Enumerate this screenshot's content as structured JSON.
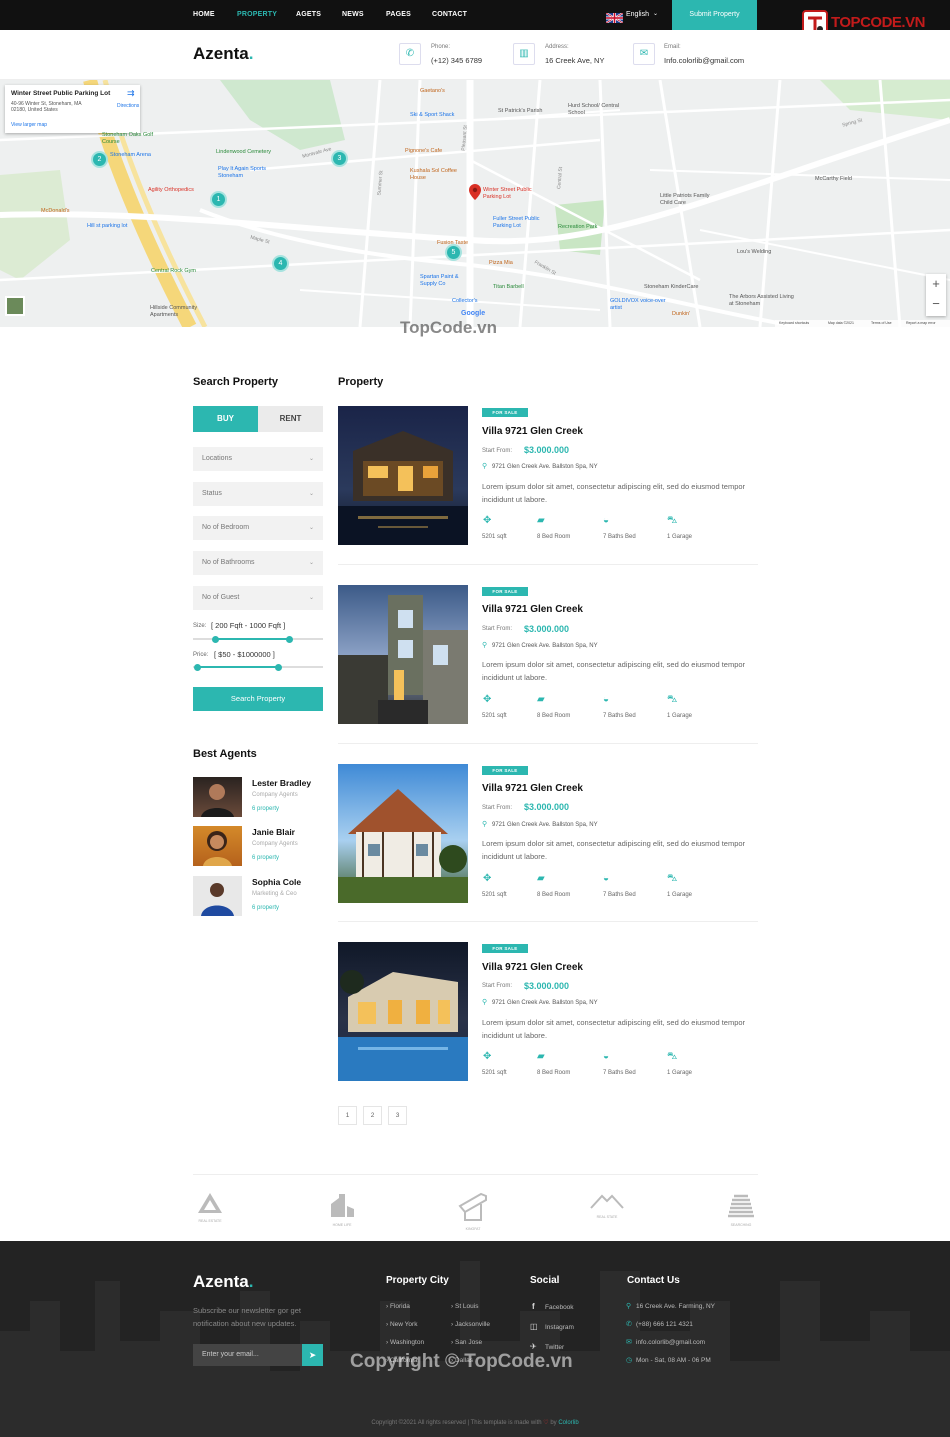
{
  "nav": {
    "items": [
      "HOME",
      "PROPERTY",
      "AGETS",
      "NEWS",
      "PAGES",
      "CONTACT"
    ],
    "active": "PROPERTY",
    "language": "English",
    "submit_label": "Submit Property"
  },
  "logo": {
    "brand": "TOPCODE.VN"
  },
  "header": {
    "logo": "Azenta",
    "logo_dot": ".",
    "phone_label": "Phone:",
    "phone": "(+12) 345 6789",
    "address_label": "Address:",
    "address": "16 Creek Ave, NY",
    "email_label": "Email:",
    "email": "Info.colorlib@gmail.com"
  },
  "map": {
    "info_title": "Winter Street Public Parking Lot",
    "info_line1": "40-96 Winter St, Stoneham, MA",
    "info_line2": "02180, United States",
    "larger_map": "View larger map",
    "directions": "Directions",
    "labels": [
      "Gaetano's",
      "Ski & Sport Shack",
      "St Patrick's Parish",
      "Hurd School/ Central School",
      "Stoneham Oaks Golf Course",
      "Lindenwood Cemetery",
      "Stoneham Arena",
      "Play It Again Sports Stoneham",
      "Pignone's Cafe",
      "Kushala Sol Coffee House",
      "Winter Street Public Parking Lot",
      "Agility Orthopedics",
      "McDonald's",
      "Hill st parking lot",
      "Fuller Street Public Parking Lot",
      "Recreation Park",
      "Little Patriots Family Child Care",
      "McCarthy Field",
      "Fusion Taste",
      "Pizza Mia",
      "Lou's Welding",
      "Central Rock Gym",
      "Spartan Paint & Supply Co",
      "Titan Barbell",
      "Stoneham KinderCare",
      "The Arbors Assisted Living at Stoneham",
      "Hillside Community Apartments",
      "Collector's",
      "GOLDIVOX voice-over artist",
      "Dunkin'",
      "Montvale Ave",
      "Maple St",
      "Pleasant St",
      "Summer St",
      "Central St",
      "Spring St",
      "Franklin St"
    ],
    "markers": [
      "1",
      "2",
      "3",
      "4",
      "5"
    ],
    "zoom_in": "+",
    "zoom_out": "−",
    "footer": [
      "Keyboard shortcuts",
      "Map data ©2021",
      "Terms of Use",
      "Report a map error"
    ],
    "google": "Google"
  },
  "watermark": {
    "top": "TopCode.vn",
    "bottom": "Copyright © TopCode.vn"
  },
  "search": {
    "title": "Search Property",
    "buy": "BUY",
    "rent": "RENT",
    "selects": [
      "Locations",
      "Status",
      "No of Bedroom",
      "No of Bathrooms",
      "No of Guest"
    ],
    "size_label": "Size:",
    "size_value": "[ 200 Fqft - 1000 Fqft ]",
    "price_label": "Price:",
    "price_value": "[ $50 - $1000000 ]",
    "size_range": [
      0.17,
      0.74
    ],
    "price_range": [
      0.03,
      0.65
    ],
    "button": "Search Property"
  },
  "agents": {
    "title": "Best Agents",
    "items": [
      {
        "name": "Lester Bradley",
        "role": "Company Agents",
        "props": "6 property"
      },
      {
        "name": "Janie Blair",
        "role": "Company Agents",
        "props": "6 property"
      },
      {
        "name": "Sophia Cole",
        "role": "Marketing & Ceo",
        "props": "6 property"
      }
    ]
  },
  "listing": {
    "title": "Property",
    "items": [
      {
        "badge": "FOR SALE",
        "title": "Villa 9721 Glen Creek",
        "start": "Start From:",
        "price": "$3.000.000",
        "address": "9721 Glen Creek Ave. Ballston Spa, NY",
        "desc": "Lorem ipsum dolor sit amet, consectetur adipiscing elit, sed do eiusmod tempor incididunt ut labore.",
        "sqft": "5201 sqft",
        "bed": "8 Bed Room",
        "bath": "7 Baths Bed",
        "garage": "1 Garage"
      },
      {
        "badge": "FOR SALE",
        "title": "Villa 9721 Glen Creek",
        "start": "Start From:",
        "price": "$3.000.000",
        "address": "9721 Glen Creek Ave. Ballston Spa, NY",
        "desc": "Lorem ipsum dolor sit amet, consectetur adipiscing elit, sed do eiusmod tempor incididunt ut labore.",
        "sqft": "5201 sqft",
        "bed": "8 Bed Room",
        "bath": "7 Baths Bed",
        "garage": "1 Garage"
      },
      {
        "badge": "FOR SALE",
        "title": "Villa 9721 Glen Creek",
        "start": "Start From:",
        "price": "$3.000.000",
        "address": "9721 Glen Creek Ave. Ballston Spa, NY",
        "desc": "Lorem ipsum dolor sit amet, consectetur adipiscing elit, sed do eiusmod tempor incididunt ut labore.",
        "sqft": "5201 sqft",
        "bed": "8 Bed Room",
        "bath": "7 Baths Bed",
        "garage": "1 Garage"
      },
      {
        "badge": "FOR SALE",
        "title": "Villa 9721 Glen Creek",
        "start": "Start From:",
        "price": "$3.000.000",
        "address": "9721 Glen Creek Ave. Ballston Spa, NY",
        "desc": "Lorem ipsum dolor sit amet, consectetur adipiscing elit, sed do eiusmod tempor incididunt ut labore.",
        "sqft": "5201 sqft",
        "bed": "8 Bed Room",
        "bath": "7 Baths Bed",
        "garage": "1 Garage"
      }
    ]
  },
  "pagination": [
    "1",
    "2",
    "3"
  ],
  "brands": [
    "REAL ESTATE",
    "HOME LIFE",
    "KINGFAT",
    "REAL STATE",
    "SEARCHING"
  ],
  "footer": {
    "logo": "Azenta",
    "logo_dot": ".",
    "newsletter": "Subscribe our newsletter gor get notification about new updates.",
    "email_placeholder": "Enter your email...",
    "city_title": "Property City",
    "cities": [
      "Florida",
      "St Louis",
      "New York",
      "Jacksonville",
      "Washington",
      "San Jose",
      "Callfornia",
      "Dallas"
    ],
    "social_title": "Social",
    "social": [
      "Facebook",
      "Instagram",
      "Twitter"
    ],
    "contact_title": "Contact Us",
    "contact": [
      "16 Creek Ave. Farming, NY",
      "(+88) 666 121 4321",
      "info.colorlib@gmail.com",
      "Mon - Sat, 08 AM - 06 PM"
    ],
    "copyright": "Copyright ©2021 All rights reserved | This template is made with",
    "by": "by",
    "colorlib": "Colorlib"
  },
  "colors": {
    "accent": "#2cb7b0",
    "dark": "#111111",
    "footer": "#232323"
  }
}
